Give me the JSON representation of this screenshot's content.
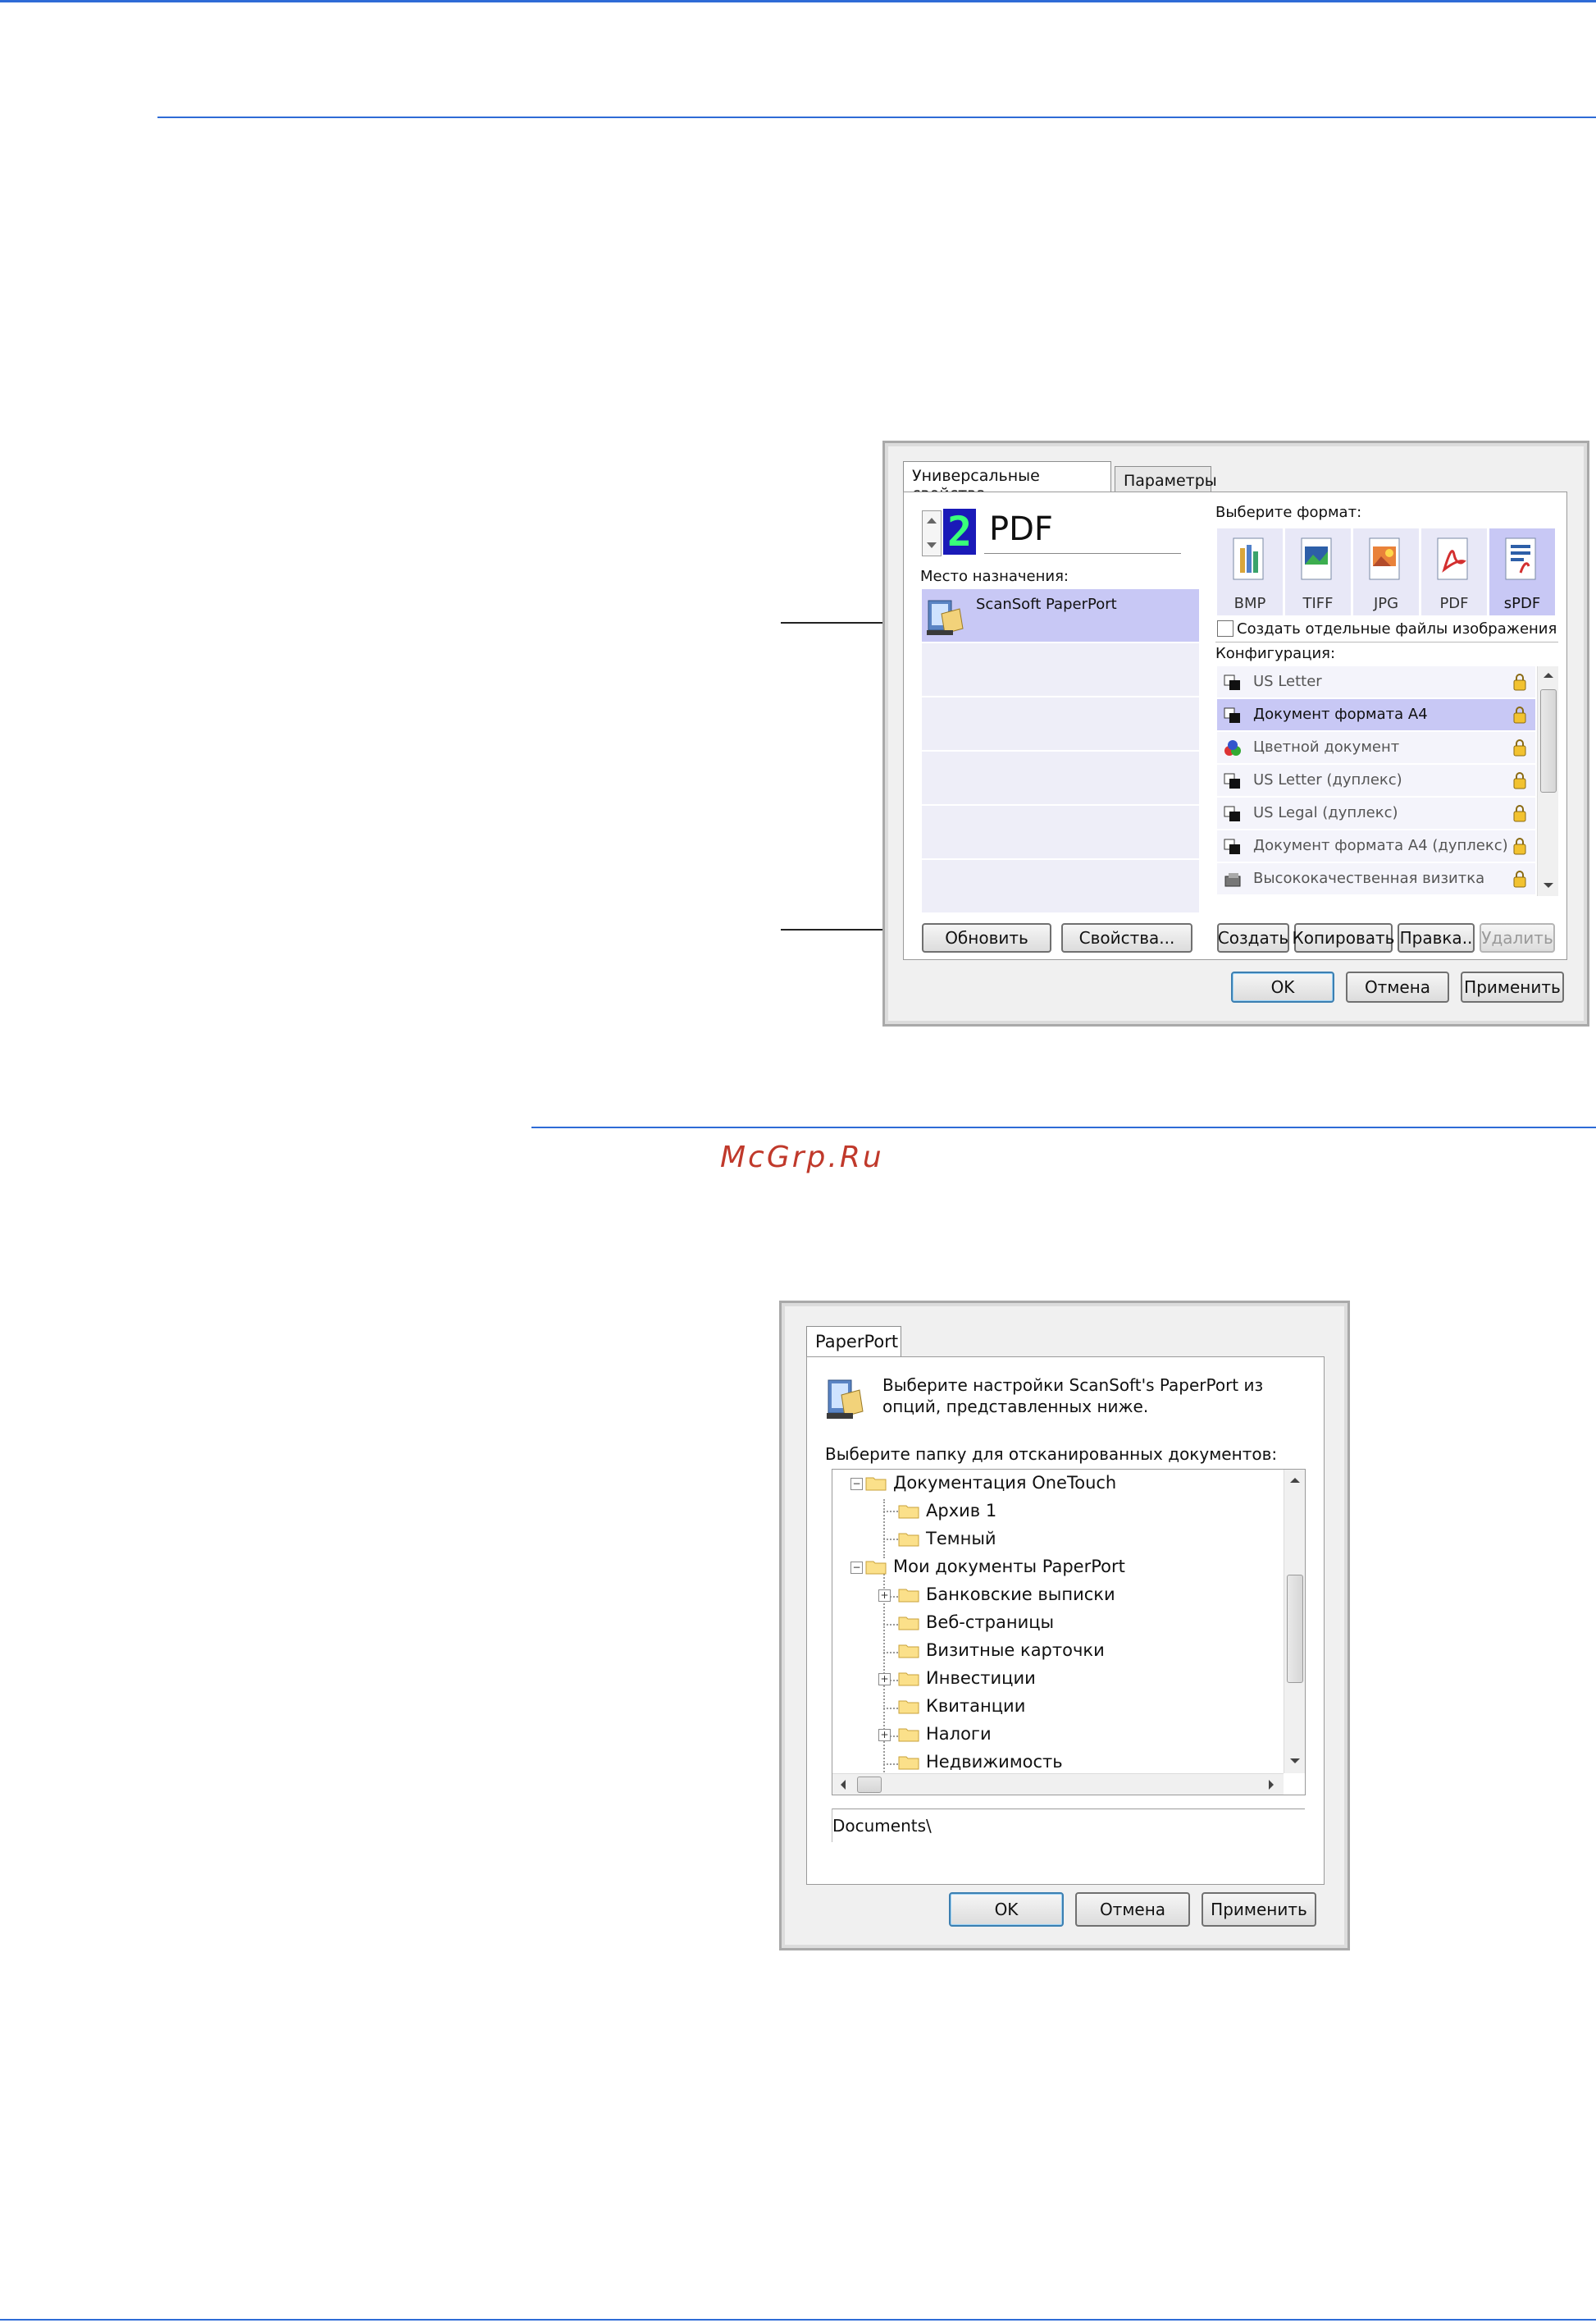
{
  "watermark": "McGrp.Ru",
  "dialog1": {
    "tabs": [
      "Универсальные свойства",
      "Параметры"
    ],
    "spinner_value": "2",
    "app_format": "PDF",
    "destination_label": "Место назначения:",
    "destinations": [
      "ScanSoft PaperPort"
    ],
    "format_label": "Выберите формат:",
    "formats": [
      "BMP",
      "TIFF",
      "JPG",
      "PDF",
      "sPDF"
    ],
    "separate_files_label": "Создать отдельные файлы изображения",
    "config_label": "Конфигурация:",
    "configs": [
      "US Letter",
      "Документ формата A4",
      "Цветной документ",
      "US Letter (дуплекс)",
      "US Legal (дуплекс)",
      "Документ формата A4 (дуплекс)",
      "Высококачественная визитка"
    ],
    "buttons": {
      "refresh": "Обновить",
      "properties": "Свойства...",
      "create": "Создать",
      "copy": "Копировать",
      "edit": "Правка..",
      "delete": "Удалить",
      "ok": "OK",
      "cancel": "Отмена",
      "apply": "Применить"
    }
  },
  "dialog2": {
    "tab": "PaperPort",
    "intro_line1": "Выберите настройки ScanSoft's PaperPort из",
    "intro_line2": "опций, представленных ниже.",
    "folder_label": "Выберите папку для отсканированных документов:",
    "tree": [
      "Документация OneTouch",
      "Архив 1",
      "Темный",
      "Мои документы PaperPort",
      "Банковские выписки",
      "Веб-страницы",
      "Визитные карточки",
      "Инвестиции",
      "Квитанции",
      "Налоги",
      "Недвижимость"
    ],
    "path": "Documents\\",
    "buttons": {
      "ok": "OK",
      "cancel": "Отмена",
      "apply": "Применить"
    }
  }
}
